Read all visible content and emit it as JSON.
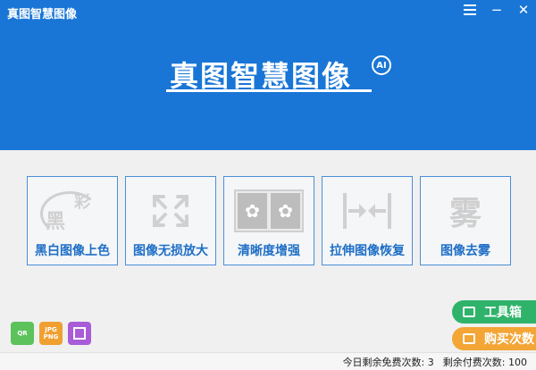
{
  "window": {
    "title": "真图智慧图像"
  },
  "logo": {
    "text": "真图智慧图像",
    "badge": "AI"
  },
  "features": [
    {
      "label": "黑白图像上色",
      "glyph_a": "黑",
      "glyph_b": "彩"
    },
    {
      "label": "图像无损放大"
    },
    {
      "label": "清晰度增强",
      "glyph": "✿"
    },
    {
      "label": "拉伸图像恢复"
    },
    {
      "label": "图像去雾",
      "glyph": "雾"
    }
  ],
  "small_icons": {
    "qr": "QR",
    "format_line1": "JPG",
    "format_line2": "PNG"
  },
  "side_buttons": {
    "toolbox": "工具箱",
    "buy": "购买次数"
  },
  "status": {
    "free_label": "今日剩余免费次数:",
    "free_count": "3",
    "paid_label": "剩余付费次数:",
    "paid_count": "100"
  },
  "colors": {
    "header": "#1976d6",
    "accent": "#1f6fc6",
    "toolbox": "#2fb36a",
    "buy": "#f3a536"
  }
}
